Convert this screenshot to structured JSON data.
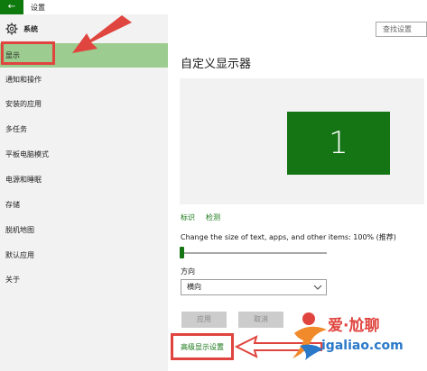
{
  "window": {
    "title": "设置",
    "back_label": "←"
  },
  "sidebar": {
    "section_title": "系统",
    "items": [
      {
        "label": "显示",
        "selected": true
      },
      {
        "label": "通知和操作"
      },
      {
        "label": "安装的应用"
      },
      {
        "label": "多任务"
      },
      {
        "label": "平板电脑模式"
      },
      {
        "label": "电源和睡眠"
      },
      {
        "label": "存储"
      },
      {
        "label": "脱机地图"
      },
      {
        "label": "默认应用"
      },
      {
        "label": "关于"
      }
    ]
  },
  "search": {
    "placeholder": "查找设置"
  },
  "main": {
    "title": "自定义显示器",
    "monitor_number": "1",
    "links": {
      "identify": "标识",
      "detect": "检测"
    },
    "scale_label": "Change the size of text, apps, and other items: 100% (推荐)",
    "scale_value_percent": 100,
    "orientation_label": "方向",
    "orientation_value": "横向",
    "apply_label": "应用",
    "cancel_label": "取消",
    "advanced_link": "高级显示设置"
  },
  "watermark": {
    "brand_cn": "爱·尬聊",
    "url": "igaliao.com"
  },
  "colors": {
    "accent": "#157515",
    "selected_bg": "#9ccc8f",
    "annotation_red": "#e0443e"
  }
}
